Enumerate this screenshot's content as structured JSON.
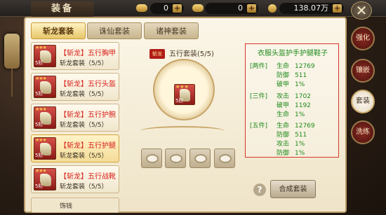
{
  "header": {
    "title": "装备",
    "close_glyph": "✕"
  },
  "resources": [
    {
      "icon": "gold-ingot-icon",
      "value": "0"
    },
    {
      "icon": "silver-ingot-icon",
      "value": "0"
    },
    {
      "icon": "coin-icon",
      "value": "138.07万"
    }
  ],
  "tabs": [
    {
      "label": "斩龙套装",
      "active": true
    },
    {
      "label": "诛仙套装",
      "active": false
    },
    {
      "label": "诸神套装",
      "active": false
    }
  ],
  "items": [
    {
      "name": "【斩龙】五行胸甲",
      "sub": "斩龙套装（5/5）",
      "level": "5阶",
      "stars": "★★★",
      "selected": false
    },
    {
      "name": "【斩龙】五行头盔",
      "sub": "斩龙套装（5/5）",
      "level": "5阶",
      "stars": "★★★",
      "selected": false
    },
    {
      "name": "【斩龙】五行护腕",
      "sub": "斩龙套装（5/5）",
      "level": "5阶",
      "stars": "★★★",
      "selected": false
    },
    {
      "name": "【斩龙】五行护腿",
      "sub": "斩龙套装（5/5）",
      "level": "5阶",
      "stars": "★★★",
      "selected": true
    },
    {
      "name": "【斩龙】五行战靴",
      "sub": "斩龙套装（5/5）",
      "level": "5阶",
      "stars": "★★★",
      "selected": false
    }
  ],
  "partial_item": {
    "name": "饰钱"
  },
  "set_panel": {
    "badge": "斩龙",
    "title": "五行套装(5/5)",
    "center_level": "5阶",
    "center_stars": "★★★"
  },
  "attributes": {
    "heading": "衣服头盔护手护腿鞋子",
    "groups": [
      {
        "tag": "[两件]",
        "rows": [
          [
            "生命",
            "12769"
          ],
          [
            "防御",
            "511"
          ],
          [
            "破甲",
            "1%"
          ]
        ]
      },
      {
        "tag": "[三件]",
        "rows": [
          [
            "攻击",
            "1702"
          ],
          [
            "破甲",
            "1192"
          ],
          [
            "生命",
            "1%"
          ]
        ]
      },
      {
        "tag": "[五件]",
        "rows": [
          [
            "生命",
            "12769"
          ],
          [
            "防御",
            "511"
          ],
          [
            "攻击",
            "1%"
          ],
          [
            "防御",
            "1%"
          ]
        ]
      }
    ]
  },
  "actions": {
    "help": "?",
    "combine": "合成套装"
  },
  "side_tabs": [
    {
      "label": "强化",
      "active": false
    },
    {
      "label": "镶嵌",
      "active": false
    },
    {
      "label": "套装",
      "active": true
    },
    {
      "label": "洗练",
      "active": false
    }
  ]
}
